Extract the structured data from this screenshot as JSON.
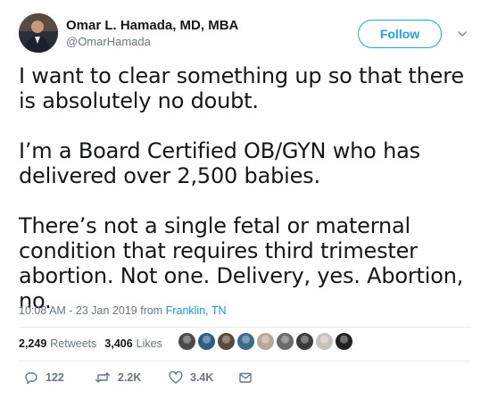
{
  "author": {
    "display_name": "Omar L. Hamada, MD, MBA",
    "handle": "@OmarHamada"
  },
  "follow_button_label": "Follow",
  "tweet_paragraphs": [
    "I want to clear something up so that there is absolutely no doubt.",
    "I’m a Board Certified OB/GYN who has delivered over 2,500 babies.",
    "There’s not a single fetal or maternal condition that requires third trimester abortion. Not one. Delivery, yes. Abortion, no."
  ],
  "meta": {
    "timestamp": "10:08 AM - 23 Jan 2019",
    "from_label": "from",
    "location": "Franklin, TN"
  },
  "stats": {
    "retweets_count": "2,249",
    "retweets_label": "Retweets",
    "likes_count": "3,406",
    "likes_label": "Likes"
  },
  "liker_colors": [
    "#4a4a4a",
    "#2d5e86",
    "#5b4a3a",
    "#3a6b8c",
    "#b8a89a",
    "#6a6a6a",
    "#3b3b3b",
    "#c9c0b8",
    "#222222"
  ],
  "actions": {
    "reply_count": "122",
    "retweet_count": "2.2K",
    "like_count": "3.4K"
  },
  "colors": {
    "accent": "#1da1f2",
    "link": "#1b95e0",
    "secondary_text": "#657786"
  }
}
